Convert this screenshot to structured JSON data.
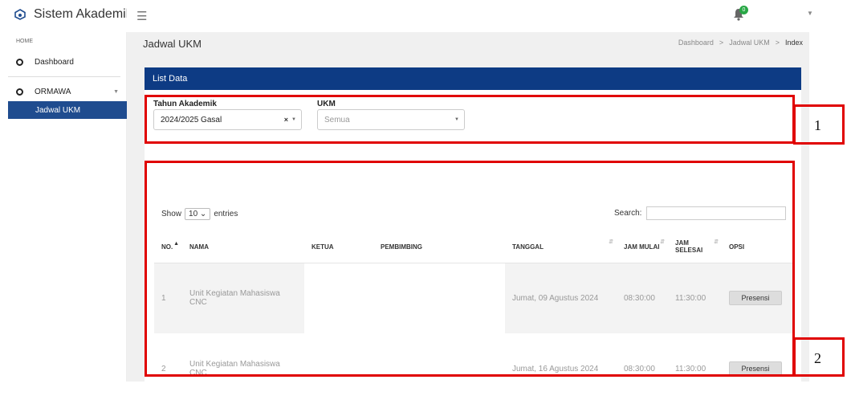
{
  "app": {
    "title": "Sistem Akademik",
    "notification_count": "0"
  },
  "sidebar": {
    "header": "HOME",
    "items": [
      {
        "label": "Dashboard"
      },
      {
        "label": "ORMAWA"
      }
    ],
    "sub_item": "Jadwal UKM"
  },
  "page": {
    "title": "Jadwal UKM",
    "breadcrumb": [
      "Dashboard",
      ">",
      "Jadwal UKM",
      ">",
      "Index"
    ]
  },
  "card": {
    "header": "List Data",
    "filters": {
      "tahun_label": "Tahun Akademik",
      "tahun_value": "2024/2025 Gasal",
      "ukm_label": "UKM",
      "ukm_placeholder": "Semua"
    },
    "table_controls": {
      "show": "Show",
      "length": "10",
      "entries": "entries",
      "search": "Search:"
    },
    "columns": [
      "NO.",
      "NAMA",
      "KETUA",
      "PEMBIMBING",
      "TANGGAL",
      "JAM MULAI",
      "JAM SELESAI",
      "OPSI"
    ],
    "rows": [
      {
        "no": "1",
        "nama": "Unit Kegiatan Mahasiswa CNC",
        "ketua": "",
        "pembimbing": "",
        "tanggal": "Jumat, 09 Agustus 2024",
        "jam_mulai": "08:30:00",
        "jam_selesai": "11:30:00",
        "opsi": "Presensi"
      },
      {
        "no": "2",
        "nama": "Unit Kegiatan Mahasiswa CNC",
        "ketua": "",
        "pembimbing": "",
        "tanggal": "Jumat, 16 Agustus 2024",
        "jam_mulai": "08:30:00",
        "jam_selesai": "11:30:00",
        "opsi": "Presensi"
      }
    ]
  },
  "annotations": {
    "label_1": "1",
    "label_2": "2",
    "color": "#e00000"
  }
}
